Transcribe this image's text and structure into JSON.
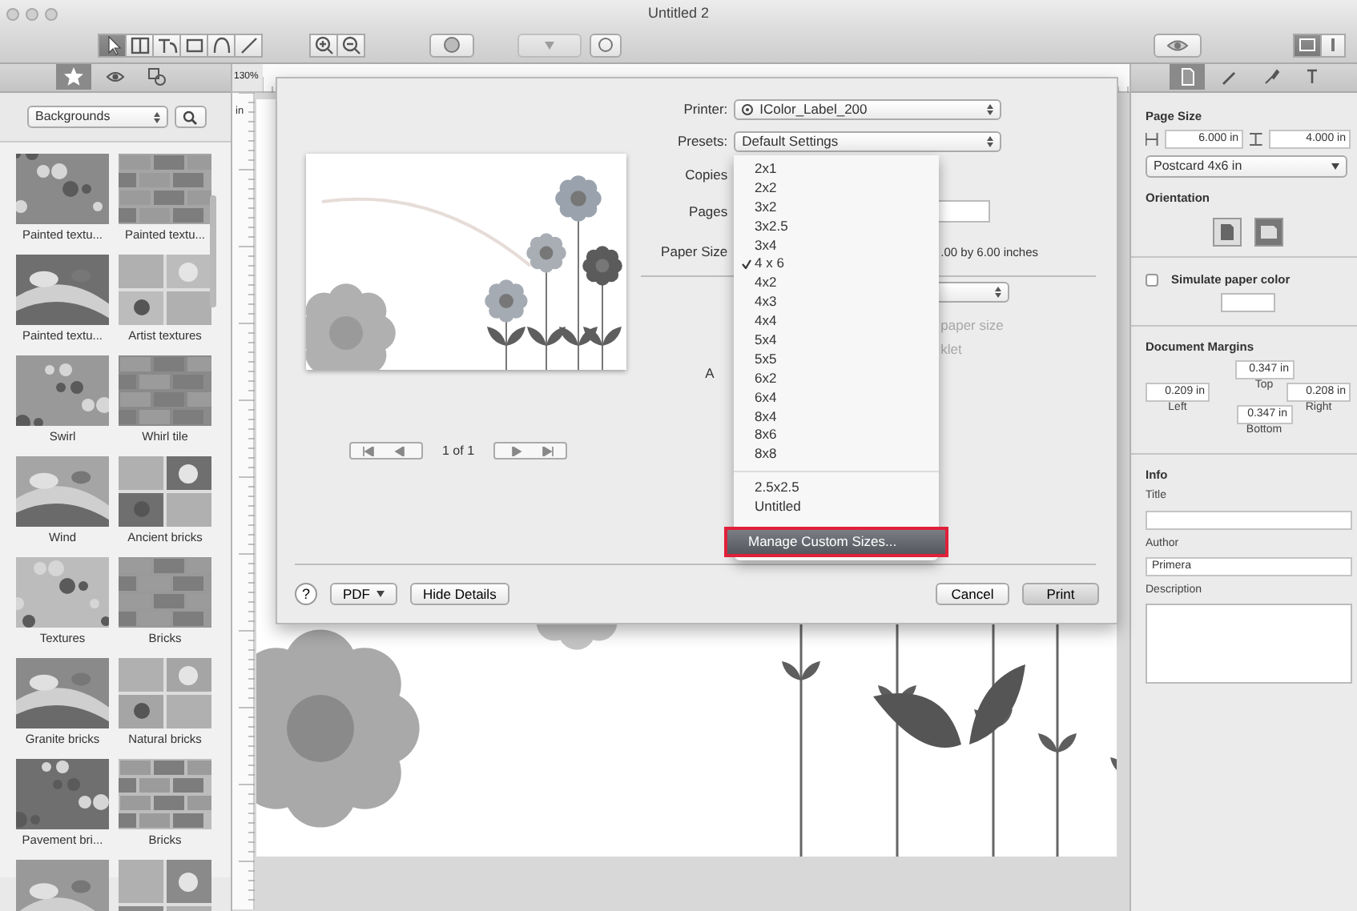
{
  "window": {
    "title": "Untitled 2"
  },
  "toolbar": {
    "tools": [
      {
        "selected": true
      },
      {
        "selected": false
      },
      {
        "selected": false
      },
      {
        "selected": false
      },
      {
        "selected": false
      },
      {
        "selected": false
      }
    ],
    "style_popup": {
      "disabled": true
    }
  },
  "library": {
    "tabs": [
      {
        "selected": true
      },
      {
        "selected": false
      },
      {
        "selected": false
      }
    ],
    "category": "Backgrounds",
    "items": [
      {
        "label": "Painted textu..."
      },
      {
        "label": "Painted textu..."
      },
      {
        "label": "Painted textu..."
      },
      {
        "label": "Artist textures"
      },
      {
        "label": "Swirl"
      },
      {
        "label": "Whirl tile"
      },
      {
        "label": "Wind"
      },
      {
        "label": "Ancient bricks"
      },
      {
        "label": "Textures"
      },
      {
        "label": "Bricks"
      },
      {
        "label": "Granite bricks"
      },
      {
        "label": "Natural bricks"
      },
      {
        "label": "Pavement bri..."
      },
      {
        "label": "Bricks"
      },
      {
        "kind": "picture"
      },
      {
        "kind": "picture"
      }
    ]
  },
  "canvas": {
    "zoom": "130%",
    "unit": "in"
  },
  "print_dialog": {
    "printer": {
      "label": "Printer:",
      "value": "IColor_Label_200"
    },
    "presets": {
      "label": "Presets:",
      "value": "Default Settings"
    },
    "copies_label": "Copies",
    "pages_label": "Pages",
    "paper_size_label": "Paper Size",
    "paper_size_note": ".00 by 6.00 inches",
    "faded_texts": [
      "paper size",
      "klet"
    ],
    "section_label": "A",
    "page_nav": "1 of 1",
    "menu": {
      "items": [
        {
          "label": "2x1",
          "selected": false
        },
        {
          "label": "2x2",
          "selected": false
        },
        {
          "label": "3x2",
          "selected": false
        },
        {
          "label": "3x2.5",
          "selected": false
        },
        {
          "label": "3x4",
          "selected": false
        },
        {
          "label": "4 x 6",
          "selected": true
        },
        {
          "label": "4x2",
          "selected": false
        },
        {
          "label": "4x3",
          "selected": false
        },
        {
          "label": "4x4",
          "selected": false
        },
        {
          "label": "5x4",
          "selected": false
        },
        {
          "label": "5x5",
          "selected": false
        },
        {
          "label": "6x2",
          "selected": false
        },
        {
          "label": "6x4",
          "selected": false
        },
        {
          "label": "8x4",
          "selected": false
        },
        {
          "label": "8x6",
          "selected": false
        },
        {
          "label": "8x8",
          "selected": false
        }
      ],
      "custom_items": [
        {
          "label": "2.5x2.5"
        },
        {
          "label": "Untitled"
        }
      ],
      "action": {
        "label": "Manage Custom Sizes...",
        "highlighted": true,
        "outlined": true
      }
    },
    "buttons": {
      "help": "?",
      "pdf": "PDF",
      "hide_details": "Hide Details",
      "cancel": "Cancel",
      "print": "Print"
    }
  },
  "inspector": {
    "tabs": [
      {
        "selected": true
      },
      {
        "selected": false
      },
      {
        "selected": false
      },
      {
        "selected": false
      }
    ],
    "page_size": {
      "title": "Page Size",
      "width": "6.000 in",
      "height": "4.000 in",
      "preset": "Postcard 4x6 in"
    },
    "orientation": {
      "title": "Orientation",
      "options": [
        {
          "selected": false
        },
        {
          "selected": true
        }
      ]
    },
    "simulate_paper_color": {
      "label": "Simulate paper color",
      "checked": false
    },
    "margins": {
      "title": "Document Margins",
      "top": {
        "value": "0.347 in",
        "label": "Top"
      },
      "left": {
        "value": "0.209 in",
        "label": "Left"
      },
      "right": {
        "value": "0.208 in",
        "label": "Right"
      },
      "bottom": {
        "value": "0.347 in",
        "label": "Bottom"
      }
    },
    "info": {
      "title": "Info",
      "fields": [
        {
          "label": "Title",
          "kind": "line"
        },
        {
          "label": "Author",
          "kind": "line",
          "value": "Primera"
        },
        {
          "label": "Description",
          "kind": "area"
        }
      ]
    }
  }
}
